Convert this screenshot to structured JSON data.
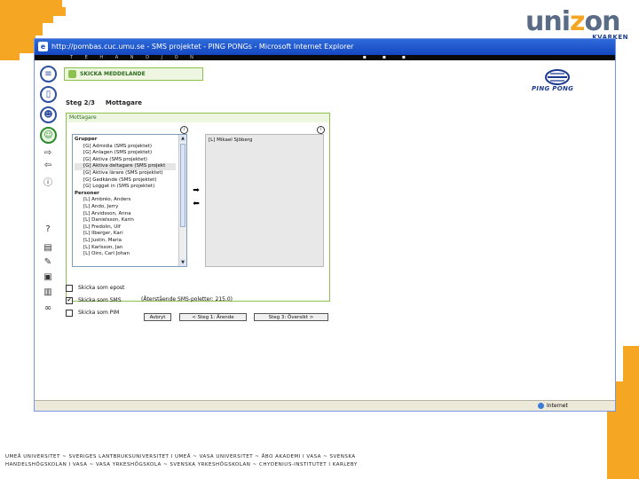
{
  "brand": {
    "name_part1": "uni",
    "name_part2": "z",
    "name_part3": "on",
    "sub": "KVARKEN"
  },
  "window": {
    "title": "http://pombas.cuc.umu.se - SMS projektet - PING PONGs - Microsoft Internet Explorer",
    "status_zone": "Internet"
  },
  "nav": {
    "letters": "T E H A N D J O N"
  },
  "header": {
    "title": "SKICKA MEDDELANDE"
  },
  "ping_pong": {
    "label": "PING PONG"
  },
  "step": {
    "number": "Steg 2/3",
    "name": "Mottagare"
  },
  "recipients_panel": {
    "legend": "Mottagare",
    "groups_heading": "Grupper",
    "groups": [
      "[G] Admidia (SMS projektet)",
      "[G] Anlagen (SMS projektet)",
      "[G] Aktiva (SMS projektet)",
      "[G] Aktiva deltagare (SMS projekt",
      "[G] Aktiva lärare (SMS projektet)",
      "[G] Gedkände (SMS projektet)",
      "[G] Loggat in (SMS projektet)"
    ],
    "persons_heading": "Personer",
    "persons": [
      "[L] Ambréo, Anders",
      "[L] Ando, Jerry",
      "[L] Arvidsson, Anna",
      "[L] Danielsson, Karin",
      "[L] Fredolin, Ulf",
      "[L] Ilberger, Kari",
      "[L] Justin, Maria",
      "[L] Karlsson, Jan",
      "[L] Oiro, Carl Johan"
    ],
    "selected": [
      "[L] Mikael Sjöberg"
    ],
    "add_arrow": "➡",
    "remove_arrow": "⬅",
    "info_symbol": "i"
  },
  "options": {
    "email_label": "Skicka som epost",
    "sms_label": "Skicka som SMS",
    "pim_label": "Skicka som PIM",
    "sms_checked": "✔",
    "sms_balance": "(Återstående SMS-poletter: 215.0)"
  },
  "buttons": {
    "cancel": "Avbryt",
    "back": "< Steg 1: Ärende",
    "next": "Steg 3: Översikt >"
  },
  "footer": {
    "line1": "UMEÅ UNIVERSITET ~ SVERIGES LANTBRUKSUNIVERSITET I UMEÅ ~ VASA UNIVERSITET ~ ÅBO AKADEMI I VASA ~ SVENSKA",
    "line2": "HANDELSHÖGSKOLAN I VASA ~ VASA YRKESHÖGSKOLA ~ SVENSKA YRKESHÖGSKOLAN ~ CHYDENIUS-INSTITUTET I KARLEBY"
  },
  "colors": {
    "accent_orange": "#f5a623",
    "titlebar_blue": "#1447c2",
    "frame_green": "#8cc04f"
  },
  "icons": {
    "left_column": [
      "list-icon",
      "book-icon",
      "forum-icon",
      "people-icon",
      "arrow-right-icon",
      "arrow-left-icon",
      "help-icon",
      "question-icon",
      "document-icon",
      "write-icon",
      "edit-icon",
      "computer-icon",
      "link-icon"
    ]
  }
}
